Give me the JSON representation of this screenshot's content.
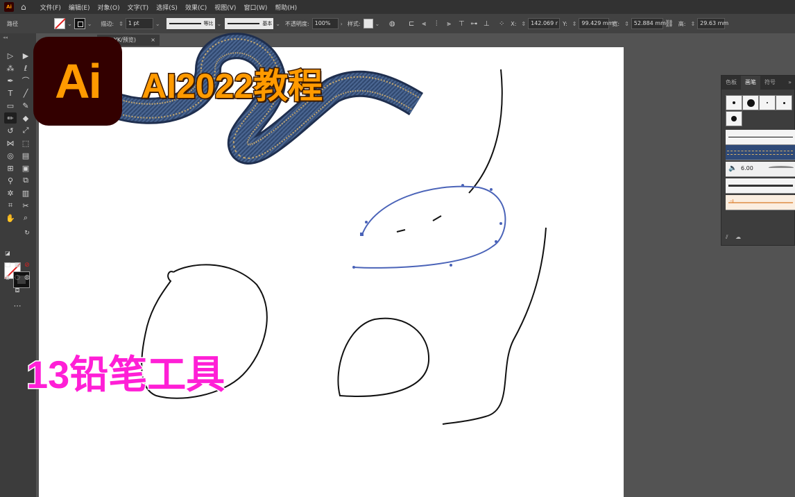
{
  "menubar": {
    "app_icon": "Ai",
    "items": [
      "文件(F)",
      "编辑(E)",
      "对象(O)",
      "文字(T)",
      "选择(S)",
      "效果(C)",
      "视图(V)",
      "窗口(W)",
      "帮助(H)"
    ]
  },
  "control": {
    "selection_label": "路径",
    "stroke_label": "描边:",
    "stroke_weight": "1 pt",
    "profile_label": "等比",
    "brush_label": "基本",
    "opacity_label": "不透明度:",
    "opacity_value": "100%",
    "style_label": "样式:",
    "x_label": "X:",
    "x_value": "142.069 r",
    "y_label": "Y:",
    "y_value": "99.429 mm",
    "w_label": "宽:",
    "w_value": "52.884 mm",
    "h_label": "高:",
    "h_value": "29.63 mm"
  },
  "document": {
    "tab_label": "YK/预览)",
    "close": "×"
  },
  "overlay": {
    "logo_text": "Ai",
    "course_title": "AI2022教程",
    "lesson_title": "13铅笔工具"
  },
  "brush_panel": {
    "tabs": [
      "色板",
      "画笔",
      "符号"
    ],
    "active_tab": "画笔",
    "brush_size": "6.00",
    "menu_glyph": "»"
  },
  "colors": {
    "accent_orange": "#ff9a00",
    "logo_bg": "#330000",
    "lesson_magenta": "#ff1fd6",
    "selection_blue": "#4a63b8"
  }
}
